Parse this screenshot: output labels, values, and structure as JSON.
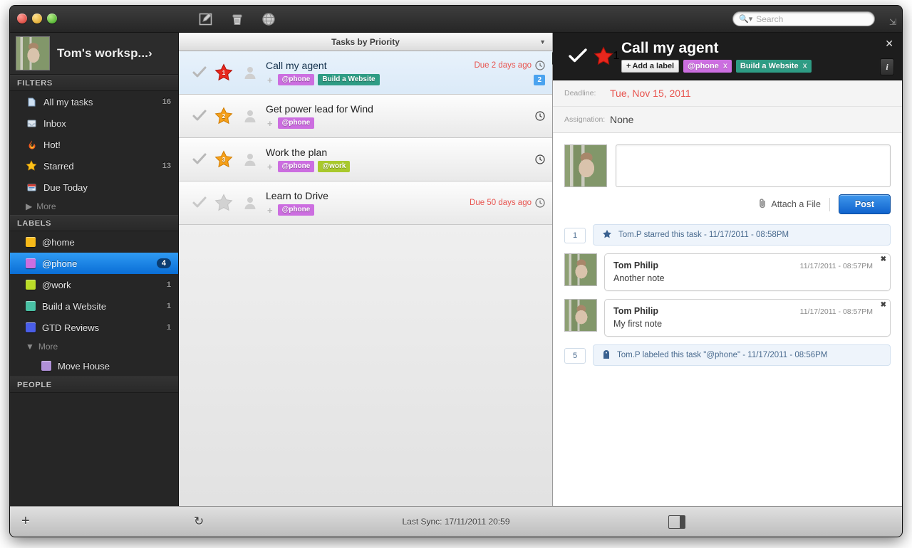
{
  "window": {
    "traffic": [
      "close",
      "minimize",
      "zoom"
    ],
    "toolbar_icons": [
      "compose-icon",
      "trash-icon",
      "globe-icon"
    ],
    "search": {
      "placeholder": "Search",
      "value": ""
    }
  },
  "sidebar": {
    "workspace": {
      "name": "Tom's worksp...",
      "chevron": "›"
    },
    "filters_header": "FILTERS",
    "filters": [
      {
        "label": "All my tasks",
        "count": "16",
        "icon": "tasks-icon"
      },
      {
        "label": "Inbox",
        "count": "",
        "icon": "inbox-icon"
      },
      {
        "label": "Hot!",
        "count": "",
        "icon": "flame-icon"
      },
      {
        "label": "Starred",
        "count": "13",
        "icon": "star-icon"
      },
      {
        "label": "Due Today",
        "count": "",
        "icon": "calendar-icon"
      }
    ],
    "filters_more": "More",
    "labels_header": "LABELS",
    "labels": [
      {
        "label": "@home",
        "count": "",
        "color": "#f6b919",
        "selected": false
      },
      {
        "label": "@phone",
        "count": "4",
        "color": "#cc6ee0",
        "selected": true
      },
      {
        "label": "@work",
        "count": "1",
        "color": "#b9dc28",
        "selected": false
      },
      {
        "label": "Build a Website",
        "count": "1",
        "color": "#49c0a4",
        "selected": false
      },
      {
        "label": "GTD Reviews",
        "count": "1",
        "color": "#4a5ee8",
        "selected": false
      }
    ],
    "labels_more": "More",
    "labels_sub": [
      {
        "label": "Move House",
        "color": "#b090d8"
      }
    ],
    "people_header": "PEOPLE"
  },
  "list": {
    "header": "Tasks by Priority",
    "tasks": [
      {
        "title": "Call my agent",
        "priority": "1",
        "star_color": "#e8271d",
        "due": "Due 2 days ago",
        "note_count": "2",
        "active": true,
        "chips": [
          {
            "text": "@phone",
            "color": "#cc6ee0"
          },
          {
            "text": "Build a Website",
            "color": "#2e9c84"
          }
        ]
      },
      {
        "title": "Get power lead for Wind",
        "priority": "2",
        "star_color": "#f5a01a",
        "due": "",
        "note_count": "",
        "active": false,
        "chips": [
          {
            "text": "@phone",
            "color": "#cc6ee0"
          }
        ]
      },
      {
        "title": "Work the plan",
        "priority": "3",
        "star_color": "#f5a01a",
        "due": "",
        "note_count": "",
        "active": false,
        "chips": [
          {
            "text": "@phone",
            "color": "#cc6ee0"
          },
          {
            "text": "@work",
            "color": "#a9c92c"
          }
        ]
      },
      {
        "title": "Learn to Drive",
        "priority": "",
        "star_color": "#cfcfcf",
        "due": "Due 50 days ago",
        "note_count": "",
        "active": false,
        "chips": [
          {
            "text": "@phone",
            "color": "#cc6ee0"
          }
        ]
      }
    ]
  },
  "detail": {
    "title": "Call my agent",
    "priority": "1",
    "star_color": "#e8271d",
    "add_label": "Add a label",
    "close": "✕",
    "info": "i",
    "chips": [
      {
        "text": "@phone",
        "color": "#cc6ee0",
        "remove": "X"
      },
      {
        "text": "Build a Website",
        "color": "#2e9c84",
        "remove": "X"
      }
    ],
    "meta": [
      {
        "key": "Deadline:",
        "value": "Tue, Nov 15, 2011",
        "red": true
      },
      {
        "key": "Assignation:",
        "value": "None",
        "red": false
      }
    ],
    "composer": {
      "value": "",
      "attach_label": "Attach a File",
      "post_label": "Post"
    },
    "feed": [
      {
        "kind": "event",
        "num": "1",
        "icon": "star-icon",
        "text": "Tom.P starred this task - 11/17/2011 - 08:58PM"
      },
      {
        "kind": "note",
        "author": "Tom Philip",
        "time": "11/17/2011 - 08:57PM",
        "text": "Another note",
        "remove": "✖"
      },
      {
        "kind": "note",
        "author": "Tom Philip",
        "time": "11/17/2011 - 08:57PM",
        "text": "My first note",
        "remove": "✖"
      },
      {
        "kind": "event",
        "num": "5",
        "icon": "label-tag-icon",
        "text": "Tom.P labeled this task \"@phone\" - 11/17/2011 - 08:56PM"
      }
    ]
  },
  "bottom": {
    "add": "+",
    "sync_icon": "refresh-icon",
    "status": "Last Sync: 17/11/2011 20:59",
    "pane_toggle": "pane-toggle-icon"
  }
}
